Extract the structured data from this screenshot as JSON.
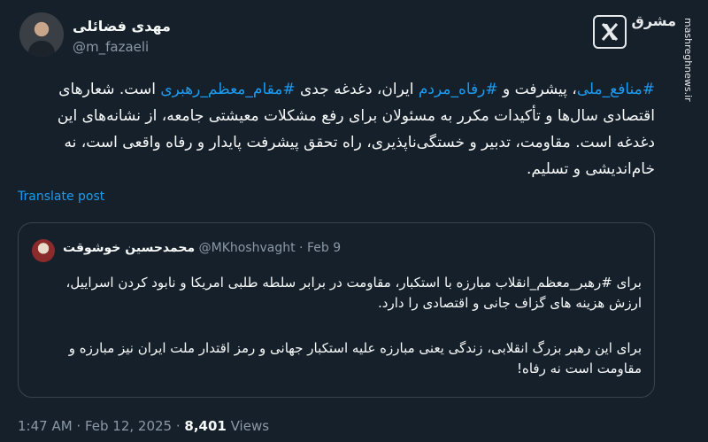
{
  "author": {
    "display_name": "مهدی فضائلی",
    "handle": "@m_fazaeli"
  },
  "brand": {
    "logo_text": "مشرق",
    "url": "mashreghnews.ir"
  },
  "icons": {
    "x_logo": "x-logo-icon",
    "verified": "none"
  },
  "tweet": {
    "hashtag_1": "#منافع_ملی",
    "sep_1": "، پیشرفت و ",
    "hashtag_2": "#رفاه_مردم",
    "sep_2": " ایران، دغدغه جدی ",
    "hashtag_3": "#مقام_معظم_رهبری",
    "rest": " است. شعارهای اقتصادی سال‌ها و تأکیدات مکرر به مسئولان برای رفع مشکلات معیشتی جامعه، از نشانه‌های این دغدغه است. مقاومت، تدبیر و خستگی‌ناپذیری، راه تحقق پیشرفت پایدار و رفاه واقعی است، نه خام‌اندیشی و تسلیم."
  },
  "translate_label": "Translate post",
  "quote": {
    "display_name": "محمدحسین خوشوقت",
    "handle": "@MKhoshvaght",
    "dot": " · ",
    "date": "Feb 9",
    "paragraph_1_prefix": "برای ",
    "paragraph_1_hashtag": "#رهبر_معظم_انقلاب",
    "paragraph_1_rest": " مبارزه با استکبار، مقاومت در برابر سلطه طلبی امریکا و نابود کردن اسراییل، ارزش هزینه های گزاف جانی و اقتصادی را دارد.",
    "paragraph_2": "برای این رهبر بزرگ انقلابی، زندگی یعنی مبارزه علیه استکبار جهانی و رمز اقتدار ملت ایران نیز مبارزه و مقاومت است نه رفاه!"
  },
  "footer": {
    "time": "1:47 AM",
    "dot": " · ",
    "date": "Feb 12, 2025",
    "views_count": "8,401",
    "views_label": " Views"
  }
}
